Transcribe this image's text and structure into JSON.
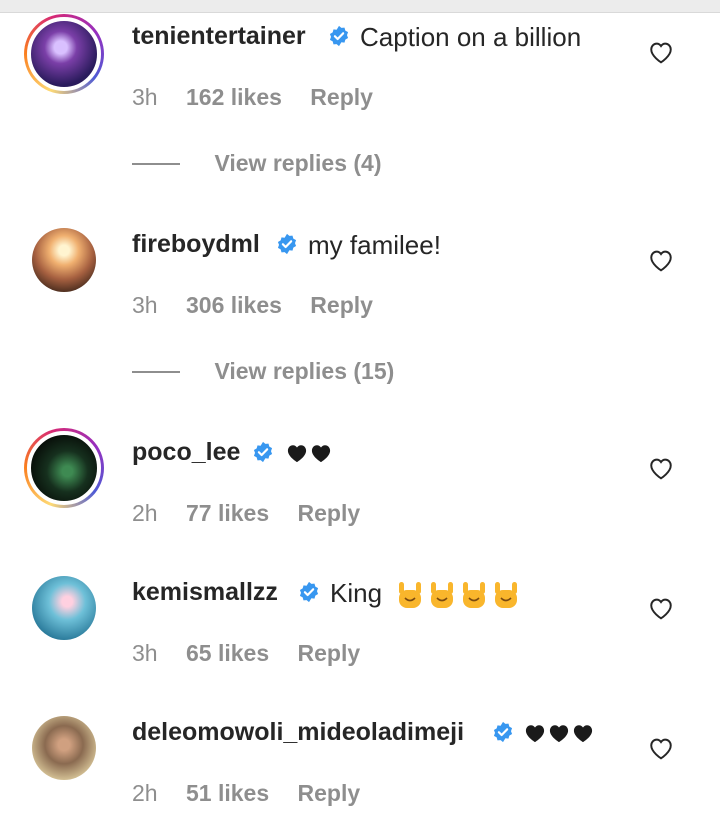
{
  "colors": {
    "text": "#262626",
    "secondary": "#8e8e8e",
    "verified": "#3897f0",
    "emoji_yellow": "#f9b62c"
  },
  "comments": [
    {
      "username": "tenientertainer",
      "verified": true,
      "text": "Caption on a billion",
      "time": "3h",
      "likes": "162 likes",
      "reply": "Reply",
      "view_replies": "View replies (4)",
      "story_ring": true
    },
    {
      "username": "fireboydml",
      "verified": true,
      "text": "my familee!",
      "time": "3h",
      "likes": "306 likes",
      "reply": "Reply",
      "view_replies": "View replies (15)",
      "story_ring": false
    },
    {
      "username": "poco_lee",
      "verified": true,
      "text": "",
      "emoji": "black-heart x2",
      "time": "2h",
      "likes": "77 likes",
      "reply": "Reply",
      "story_ring": true
    },
    {
      "username": "kemismallzz",
      "verified": true,
      "text": "King",
      "emoji": "sign-of-the-horns x4",
      "time": "3h",
      "likes": "65 likes",
      "reply": "Reply",
      "story_ring": false
    },
    {
      "username": "deleomowoli_mideoladimeji",
      "verified": true,
      "text": "",
      "emoji": "black-heart x3",
      "time": "2h",
      "likes": "51 likes",
      "reply": "Reply",
      "story_ring": false
    }
  ]
}
